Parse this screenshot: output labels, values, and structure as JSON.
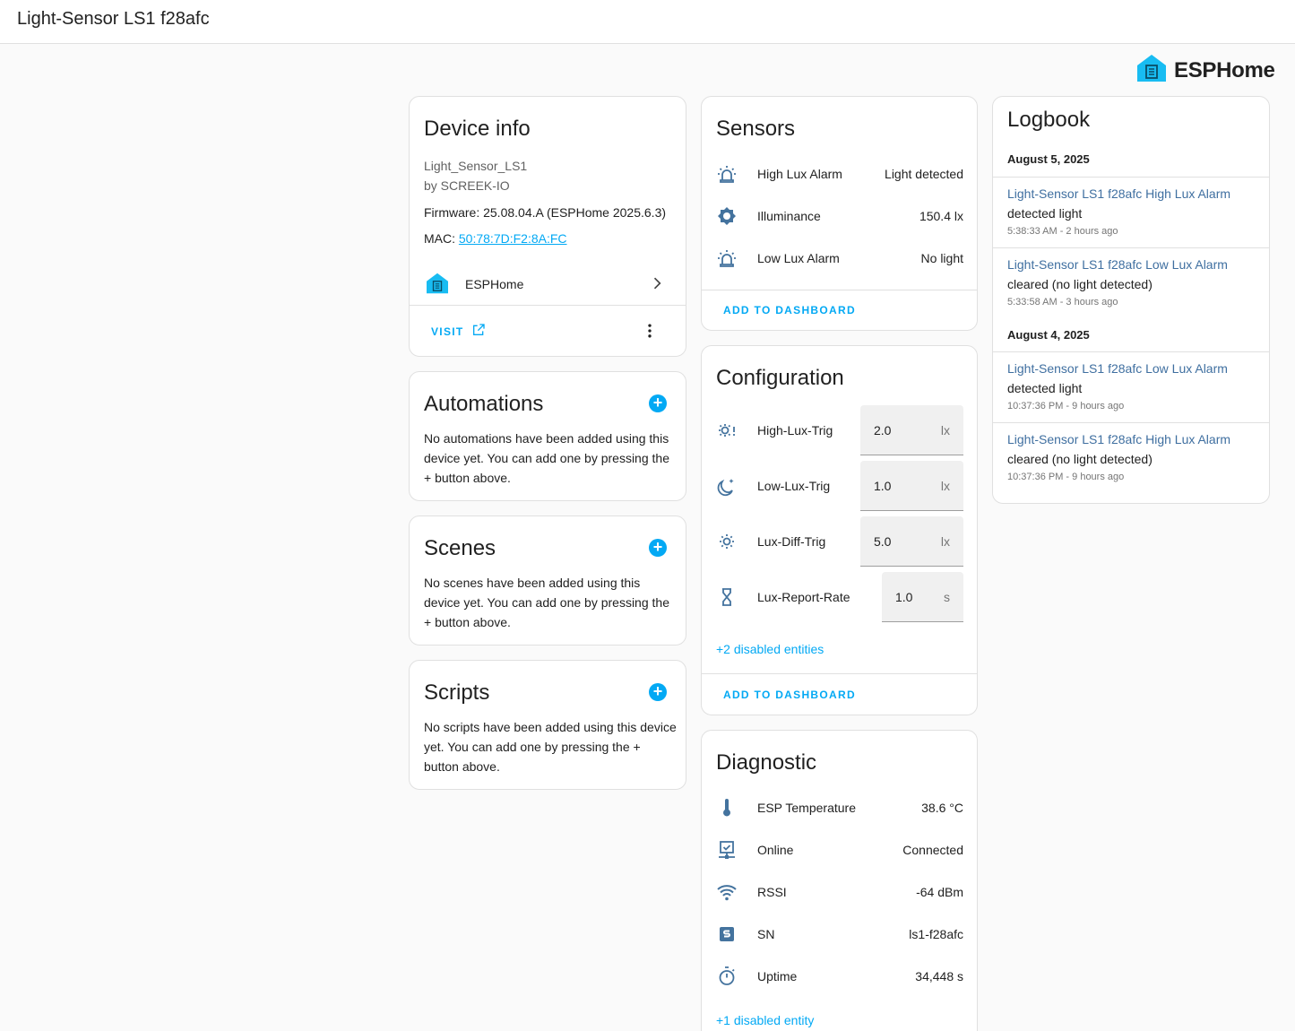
{
  "header": {
    "title": "Light-Sensor LS1 f28afc"
  },
  "brand": {
    "name": "ESPHome",
    "color": "#18bcf2"
  },
  "device_info": {
    "title": "Device info",
    "model": "Light_Sensor_LS1",
    "manufacturer": "by SCREEK-IO",
    "firmware": "Firmware: 25.08.04.A (ESPHome 2025.6.3)",
    "mac_label": "MAC:",
    "mac": "50:78:7D:F2:8A:FC",
    "integration": "ESPHome",
    "visit_label": "VISIT"
  },
  "automations": {
    "title": "Automations",
    "text": "No automations have been added using this device yet. You can add one by pressing the + button above."
  },
  "scenes": {
    "title": "Scenes",
    "text": "No scenes have been added using this device yet. You can add one by pressing the + button above."
  },
  "scripts": {
    "title": "Scripts",
    "text": "No scripts have been added using this device yet. You can add one by pressing the + button above."
  },
  "sensors": {
    "title": "Sensors",
    "items": [
      {
        "icon": "alarm-light-icon",
        "label": "High Lux Alarm",
        "value": "Light detected"
      },
      {
        "icon": "brightness-icon",
        "label": "Illuminance",
        "value": "150.4 lx"
      },
      {
        "icon": "alarm-light-icon",
        "label": "Low Lux Alarm",
        "value": "No light"
      }
    ],
    "add_label": "ADD TO DASHBOARD"
  },
  "configuration": {
    "title": "Configuration",
    "items": [
      {
        "icon": "sun-alert-icon",
        "label": "High-Lux-Trig",
        "value": "2.0",
        "unit": "lx"
      },
      {
        "icon": "moon-star-icon",
        "label": "Low-Lux-Trig",
        "value": "1.0",
        "unit": "lx"
      },
      {
        "icon": "sun-icon",
        "label": "Lux-Diff-Trig",
        "value": "5.0",
        "unit": "lx"
      },
      {
        "icon": "hourglass-icon",
        "label": "Lux-Report-Rate",
        "value": "1.0",
        "unit": "s"
      }
    ],
    "disabled_label": "+2 disabled entities",
    "add_label": "ADD TO DASHBOARD"
  },
  "diagnostic": {
    "title": "Diagnostic",
    "items": [
      {
        "icon": "thermometer-icon",
        "label": "ESP Temperature",
        "value": "38.6 °C"
      },
      {
        "icon": "monitor-check-icon",
        "label": "Online",
        "value": "Connected"
      },
      {
        "icon": "wifi-icon",
        "label": "RSSI",
        "value": "-64 dBm"
      },
      {
        "icon": "serial-number-icon",
        "label": "SN",
        "value": "ls1-f28afc"
      },
      {
        "icon": "timer-icon",
        "label": "Uptime",
        "value": "34,448 s"
      }
    ],
    "disabled_label": "+1 disabled entity"
  },
  "logbook": {
    "title": "Logbook",
    "groups": [
      {
        "date": "August 5, 2025",
        "entries": [
          {
            "entity": "Light-Sensor LS1 f28afc High Lux Alarm",
            "message": "detected light",
            "time": "5:38:33 AM - 2 hours ago"
          },
          {
            "entity": "Light-Sensor LS1 f28afc Low Lux Alarm",
            "message": "cleared (no light detected)",
            "time": "5:33:58 AM - 3 hours ago"
          }
        ]
      },
      {
        "date": "August 4, 2025",
        "entries": [
          {
            "entity": "Light-Sensor LS1 f28afc Low Lux Alarm",
            "message": "detected light",
            "time": "10:37:36 PM - 9 hours ago"
          },
          {
            "entity": "Light-Sensor LS1 f28afc High Lux Alarm",
            "message": "cleared (no light detected)",
            "time": "10:37:36 PM - 9 hours ago"
          }
        ]
      }
    ]
  },
  "colors": {
    "accent": "#03a9f4",
    "icon": "#44739e",
    "log_link": "#3f6fa0"
  }
}
